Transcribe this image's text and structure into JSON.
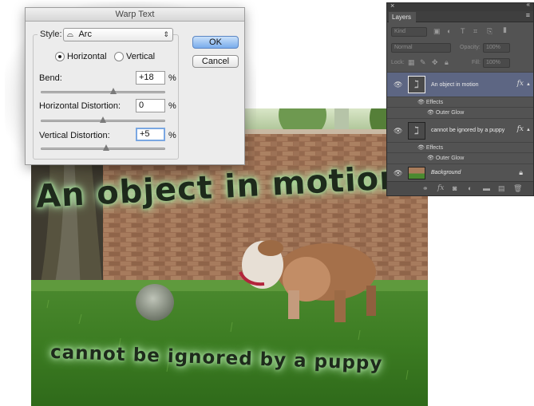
{
  "canvas": {
    "headline": "An object in motion",
    "subline": "cannot be ignored by a puppy"
  },
  "warp_dialog": {
    "title": "Warp Text",
    "style_label": "Style:",
    "style_value": "Arc",
    "orientation": {
      "horizontal_label": "Horizontal",
      "vertical_label": "Vertical",
      "selected": "Horizontal"
    },
    "bend": {
      "label": "Bend:",
      "value": "+18",
      "unit": "%",
      "level_percent": 18
    },
    "horizontal_distortion": {
      "label": "Horizontal Distortion:",
      "value": "0",
      "unit": "%",
      "level_percent": 0
    },
    "vertical_distortion": {
      "label": "Vertical Distortion:",
      "value": "+5",
      "unit": "%",
      "level_percent": 5
    },
    "ok_label": "OK",
    "cancel_label": "Cancel",
    "accent_color": "#79acec"
  },
  "layers_panel": {
    "close_glyph": "×",
    "collapse_glyph": "«",
    "tab_label": "Layers",
    "filter_kind": "Kind",
    "blend_mode": "Normal",
    "opacity_label": "Opacity:",
    "opacity_value": "100%",
    "lock_label": "Lock:",
    "fill_label": "Fill:",
    "fill_value": "100%",
    "layers": [
      {
        "name": "An object in motion",
        "selected": true,
        "effects_label": "Effects",
        "effect": "Outer Glow"
      },
      {
        "name": "cannot be ignored by a puppy",
        "selected": false,
        "effects_label": "Effects",
        "effect": "Outer Glow"
      },
      {
        "name": "Background",
        "selected": false
      }
    ],
    "fx_label": "fx",
    "selection_color": "#5d6683"
  }
}
